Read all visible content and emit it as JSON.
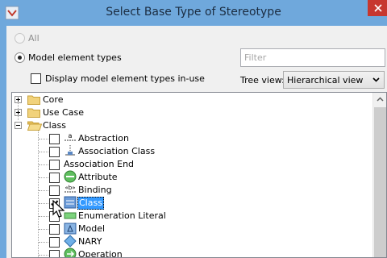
{
  "window": {
    "title": "Select Base Type of Stereotype"
  },
  "options": {
    "all_label": "All",
    "model_element_types_label": "Model element types",
    "display_in_use_label": "Display model element types in-use"
  },
  "filter": {
    "placeholder": "Filter"
  },
  "tree_view": {
    "label": "Tree view:",
    "selected": "Hierarchical view"
  },
  "tree": {
    "folders": [
      {
        "label": "Core",
        "expanded": false
      },
      {
        "label": "Use Case",
        "expanded": false
      },
      {
        "label": "Class",
        "expanded": true
      }
    ],
    "items": [
      {
        "label": "Abstraction",
        "checked": false,
        "icon": "abstraction-icon"
      },
      {
        "label": "Association Class",
        "checked": false,
        "icon": "association-class-icon"
      },
      {
        "label": "Association End",
        "checked": false,
        "icon": "none"
      },
      {
        "label": "Attribute",
        "checked": false,
        "icon": "attribute-icon"
      },
      {
        "label": "Binding",
        "checked": false,
        "icon": "binding-icon"
      },
      {
        "label": "Class",
        "checked": true,
        "icon": "class-icon",
        "selected": true
      },
      {
        "label": "Enumeration Literal",
        "checked": false,
        "icon": "enumeration-literal-icon"
      },
      {
        "label": "Model",
        "checked": false,
        "icon": "model-icon"
      },
      {
        "label": "NARY",
        "checked": false,
        "icon": "nary-icon"
      },
      {
        "label": "Operation",
        "checked": false,
        "icon": "operation-icon"
      }
    ]
  },
  "colors": {
    "titlebar": "#6fa8dc",
    "selection": "#3399ff",
    "close": "#c7372f"
  }
}
